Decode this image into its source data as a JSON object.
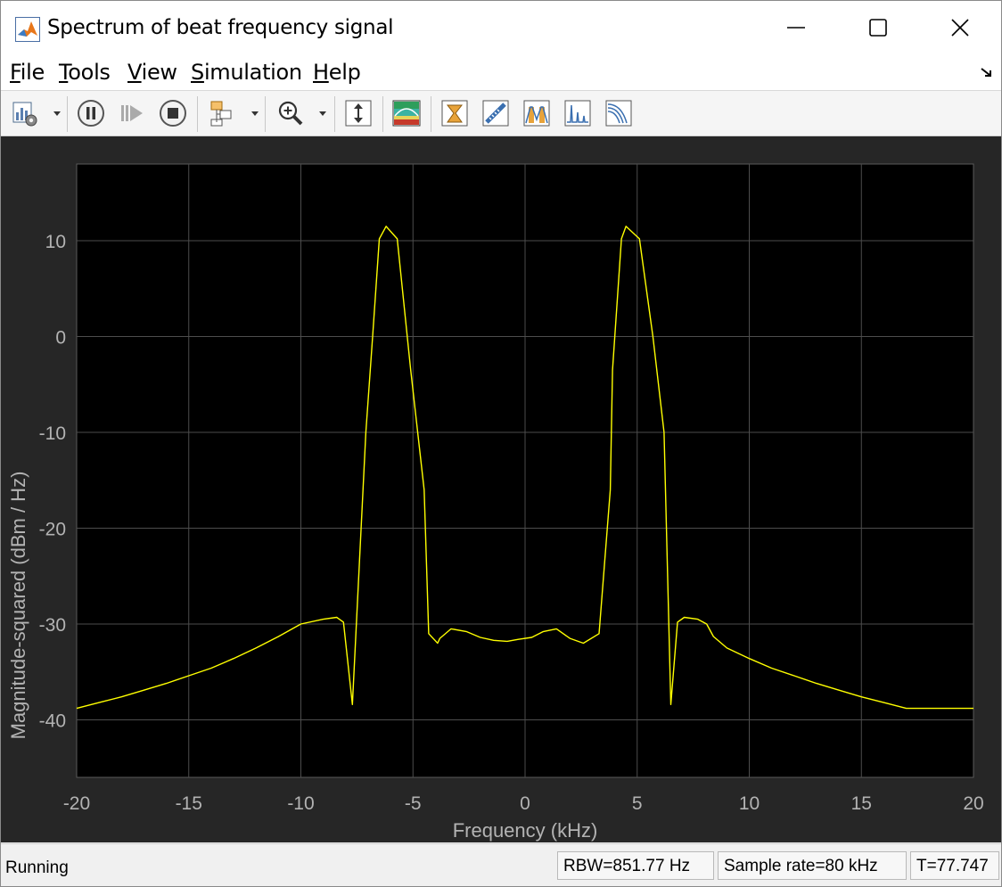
{
  "window": {
    "title": "Spectrum of beat frequency signal",
    "icon": "matlab-icon",
    "controls": [
      "minimize-icon",
      "maximize-icon",
      "close-icon"
    ]
  },
  "menu": {
    "items": [
      {
        "label": "File",
        "mnemonic": "F"
      },
      {
        "label": "Tools",
        "mnemonic": "T"
      },
      {
        "label": "View",
        "mnemonic": "V"
      },
      {
        "label": "Simulation",
        "mnemonic": "S"
      },
      {
        "label": "Help",
        "mnemonic": "H"
      }
    ],
    "undock_icon": "undock-arrow-icon"
  },
  "toolbar": {
    "buttons": [
      {
        "icon": "settings-icon",
        "dropdown": true
      },
      {
        "icon": "pause-icon"
      },
      {
        "icon": "step-forward-icon"
      },
      {
        "icon": "stop-icon"
      },
      {
        "icon": "highlight-simulink-block-icon",
        "dropdown": true
      },
      {
        "icon": "zoom-in-icon",
        "dropdown": true
      },
      {
        "icon": "scale-axes-icon"
      },
      {
        "icon": "spectrogram-icon"
      },
      {
        "icon": "data-cursors-icon"
      },
      {
        "icon": "measurements-icon"
      },
      {
        "icon": "peak-finder-icon"
      },
      {
        "icon": "distortion-measurements-icon"
      },
      {
        "icon": "ccdf-icon"
      }
    ]
  },
  "colors": {
    "plot_background": "#000000",
    "panel_background": "#262626",
    "trace": "#ffff00",
    "grid": "#4d4d4d",
    "tick_text": "#b3b3b3"
  },
  "chart_data": {
    "type": "line",
    "xlabel": "Frequency (kHz)",
    "ylabel": "Magnitude-squared (dBm / Hz)",
    "xlim": [
      -20,
      20
    ],
    "ylim": [
      -46,
      18
    ],
    "xticks": [
      -20,
      -15,
      -10,
      -5,
      0,
      5,
      10,
      15,
      20
    ],
    "yticks": [
      10,
      0,
      -10,
      -20,
      -30,
      -40
    ],
    "grid": true,
    "series": [
      {
        "color": "#ffff00",
        "x": [
          -20,
          -19,
          -18,
          -17,
          -16,
          -15,
          -14,
          -13,
          -12,
          -11,
          -10,
          -9,
          -8.4,
          -8.1,
          -7.7,
          -7.1,
          -6.8,
          -6.5,
          -6.2,
          -5.7,
          -5.1,
          -4.5,
          -4.3,
          -3.9,
          -3.8,
          -3.3,
          -2.6,
          -2.0,
          -1.4,
          -0.8,
          -0.3,
          0.3,
          0.8,
          1.4,
          2.0,
          2.6,
          3.3,
          3.8,
          3.9,
          4.3,
          4.5,
          5.1,
          5.7,
          6.2,
          6.5,
          6.8,
          7.1,
          7.7,
          8.1,
          8.4,
          9,
          10,
          11,
          12,
          13,
          14,
          15,
          16,
          17,
          18,
          19,
          20
        ],
        "y": [
          -38.8,
          -38.2,
          -37.6,
          -36.9,
          -36.2,
          -35.4,
          -34.6,
          -33.6,
          -32.5,
          -31.3,
          -30.0,
          -29.5,
          -29.3,
          -29.8,
          -38.4,
          -10.0,
          0.0,
          10.2,
          11.5,
          10.2,
          -3.5,
          -16.0,
          -31.0,
          -32.0,
          -31.5,
          -30.5,
          -30.8,
          -31.4,
          -31.7,
          -31.8,
          -31.6,
          -31.4,
          -30.8,
          -30.5,
          -31.5,
          -32.0,
          -31.0,
          -16.0,
          -3.5,
          10.2,
          11.5,
          10.2,
          0.0,
          -10.0,
          -38.4,
          -29.8,
          -29.3,
          -29.5,
          -30.0,
          -31.3,
          -32.5,
          -33.6,
          -34.6,
          -35.4,
          -36.2,
          -36.9,
          -37.6,
          -38.2,
          -38.8,
          -38.8,
          -38.8,
          -38.8
        ]
      }
    ]
  },
  "status": {
    "state": "Running",
    "rbw": "RBW=851.77 Hz",
    "sample_rate": "Sample rate=80 kHz",
    "time": "T=77.747"
  }
}
